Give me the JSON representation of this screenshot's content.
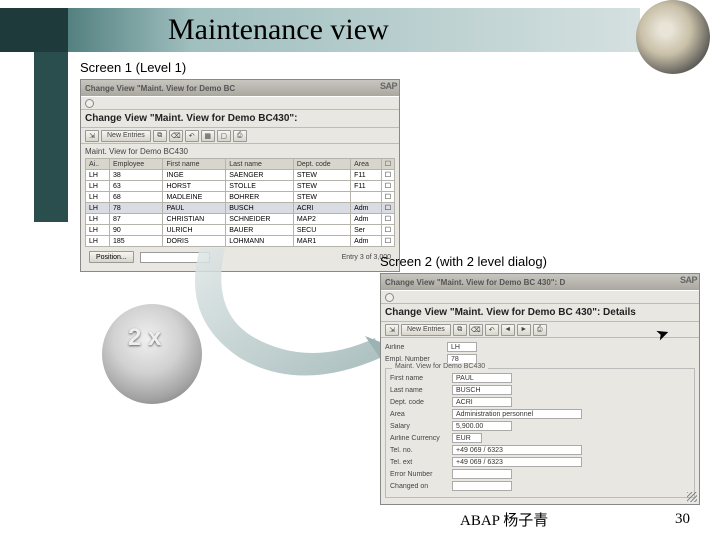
{
  "header": {
    "title": "Maintenance view"
  },
  "screen1": {
    "caption": "Screen 1 (Level 1)",
    "titlebar": "Change View \"Maint. View for Demo BC",
    "logo": "SAP",
    "bold_row": "Change View \"Maint. View for Demo BC430\":",
    "toolbar": {
      "new_entries": "New Entries"
    },
    "table_label": "Maint. View for Demo BC430",
    "columns": [
      "Ai..",
      "Employee",
      "First name",
      "Last name",
      "Dept. code",
      "Area"
    ],
    "rows": [
      {
        "ai": "LH",
        "emp": "38",
        "first": "INGE",
        "last": "SAENGER",
        "dept": "STEW",
        "area": "F11"
      },
      {
        "ai": "LH",
        "emp": "63",
        "first": "HORST",
        "last": "STOLLE",
        "dept": "STEW",
        "area": "F11"
      },
      {
        "ai": "LH",
        "emp": "68",
        "first": "MADLEINE",
        "last": "BOHRER",
        "dept": "STEW",
        "area": ""
      },
      {
        "ai": "LH",
        "emp": "78",
        "first": "PAUL",
        "last": "BUSCH",
        "dept": "ACRI",
        "area": "Adm",
        "sel": true
      },
      {
        "ai": "LH",
        "emp": "87",
        "first": "CHRISTIAN",
        "last": "SCHNEIDER",
        "dept": "MAP2",
        "area": "Adm"
      },
      {
        "ai": "LH",
        "emp": "90",
        "first": "ULRICH",
        "last": "BAUER",
        "dept": "SECU",
        "area": "Ser"
      },
      {
        "ai": "LH",
        "emp": "185",
        "first": "DORIS",
        "last": "LOHMANN",
        "dept": "MAR1",
        "area": "Adm"
      }
    ],
    "status": {
      "position": "Position...",
      "entries": "Entry 3          of 3,000"
    }
  },
  "screen2": {
    "caption": "Screen 2 (with 2 level dialog)",
    "titlebar": "Change View \"Maint. View for Demo BC 430\": D",
    "logo": "SAP",
    "bold_row": "Change View \"Maint. View for Demo BC 430\": Details",
    "toolbar": {
      "new_entries": "New Entries"
    },
    "top_fields": [
      {
        "label": "Airline",
        "value": "LH",
        "w": "w1"
      },
      {
        "label": "Empl. Number",
        "value": "78",
        "w": "w1"
      }
    ],
    "group_label": "Maint. View for Demo BC430",
    "detail_fields": [
      {
        "label": "First name",
        "value": "PAUL",
        "w": "w2"
      },
      {
        "label": "Last name",
        "value": "BUSCH",
        "w": "w2"
      },
      {
        "label": "Dept. code",
        "value": "ACRI",
        "w": "w2"
      },
      {
        "label": "Area",
        "value": "Administration personnel",
        "w": "w3"
      },
      {
        "label": "Salary",
        "value": "5,900.00",
        "w": "w2"
      },
      {
        "label": "Airline Currency",
        "value": "EUR",
        "w": "w1"
      },
      {
        "label": "Tel. no.",
        "value": "+49 069 / 6323",
        "w": "w3"
      },
      {
        "label": "Tel. ext",
        "value": "+49 069 / 6323",
        "w": "w3"
      },
      {
        "label": "Error Number",
        "value": "",
        "w": "w2"
      },
      {
        "label": "Changed on",
        "value": "",
        "w": "w2"
      }
    ]
  },
  "dblclick": {
    "label": "2 x"
  },
  "footer": {
    "credit": "ABAP 杨子青",
    "page": "30"
  }
}
